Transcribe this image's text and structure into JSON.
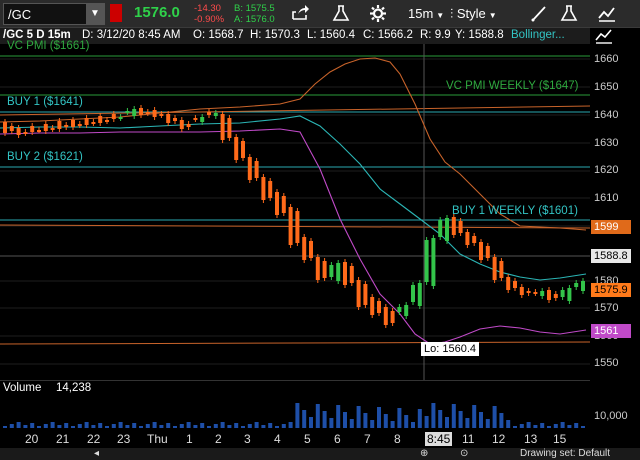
{
  "toolbar": {
    "symbol": "/GC",
    "last_price": "1576.0",
    "change": "-14.30",
    "change_pct": "-0.90%",
    "bid": "B: 1575.5",
    "ask": "A: 1576.0",
    "interval": "15m",
    "style_label": "Style"
  },
  "info": {
    "title": "/GC 5 D 15m",
    "datetime": "D: 3/12/20 8:45 AM",
    "open": "O: 1568.7",
    "high": "H: 1570.3",
    "low": "L: 1560.4",
    "close": "C: 1566.2",
    "range": "R: 9.9",
    "y": "Y: 1588.8",
    "study": "Bollinger..."
  },
  "levels": {
    "vc_pmi": "VC PMI ($1661)",
    "vc_pmi_weekly": "VC PMI WEEKLY ($1647)",
    "buy1": "BUY 1 ($1641)",
    "buy2": "BUY 2 ($1621)",
    "buy1_weekly": "BUY 1 WEEKLY ($1601)",
    "low_label": "Lo: 1560.4"
  },
  "price_axis": [
    "1660",
    "1650",
    "1640",
    "1630",
    "1620",
    "1610",
    "1600",
    "1580",
    "1570",
    "1560",
    "1550"
  ],
  "tags": {
    "t1599": "1599",
    "t1588": "1588.8",
    "t1575": "1575.9",
    "t1561": "1561"
  },
  "volume": {
    "label": "Volume",
    "value": "14,238",
    "axis": "10,000"
  },
  "x_axis": [
    "20",
    "21",
    "22",
    "23",
    "Thu",
    "1",
    "2",
    "3",
    "4",
    "5",
    "6",
    "7",
    "8",
    "8:45",
    "11",
    "12",
    "13",
    "15"
  ],
  "bottom": {
    "drawing_set": "Drawing set: Default"
  },
  "colors": {
    "up": "#33c44a",
    "down": "#ff6a1a",
    "bb_mid": "#2bb5b5",
    "bb_low": "#c04ac8",
    "bb_up": "#c8632a",
    "level": "#2aa7b0"
  }
}
